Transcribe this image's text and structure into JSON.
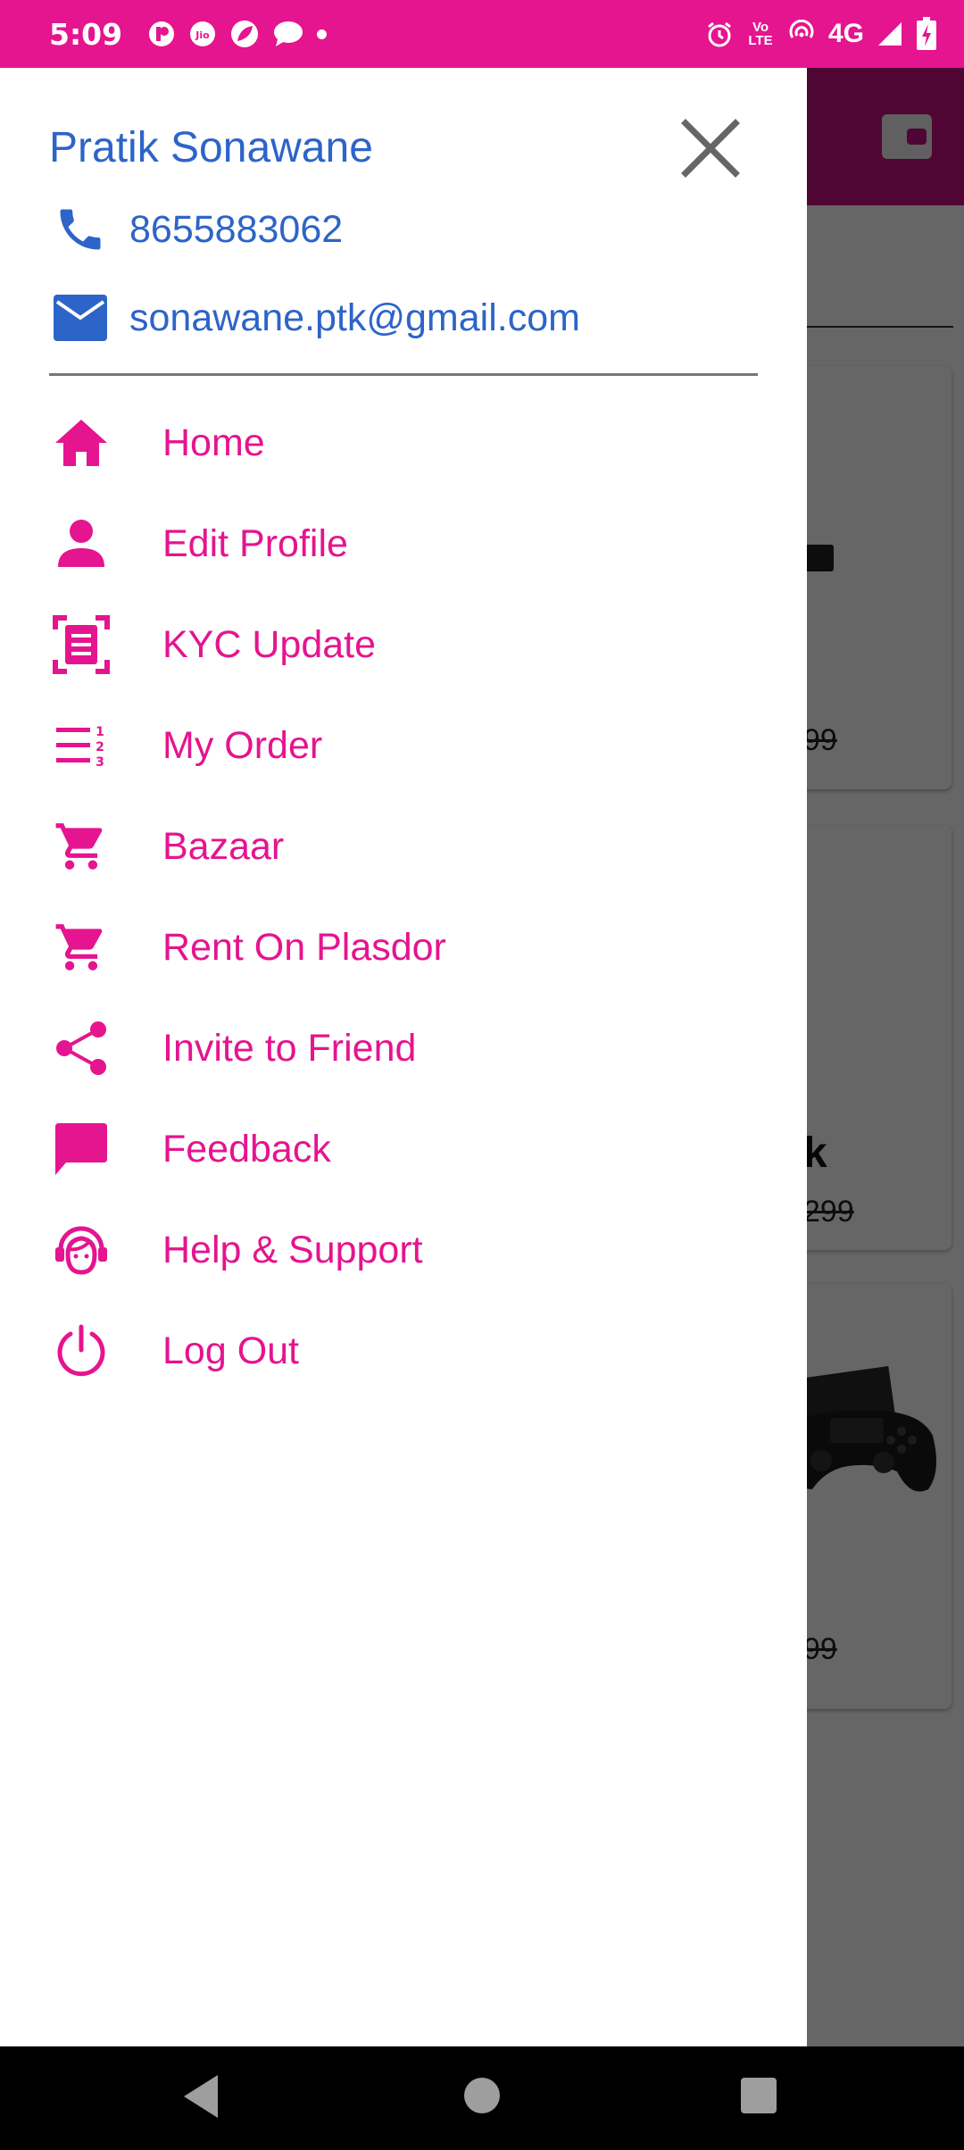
{
  "status_bar": {
    "time": "5:09",
    "network": "4G",
    "volte": "Vo LTE",
    "icons": [
      "notification-icon",
      "jio-icon",
      "leaf-icon",
      "message-icon",
      "alarm-icon",
      "hotspot-icon",
      "signal-icon",
      "battery-charging-icon"
    ]
  },
  "background": {
    "prices": [
      "99",
      "299",
      "99"
    ],
    "price_partial_letter": "k"
  },
  "drawer": {
    "user_name": "Pratik Sonawane",
    "phone": "8655883062",
    "email": "sonawane.ptk@gmail.com",
    "menu": [
      {
        "label": "Home",
        "icon": "home-icon"
      },
      {
        "label": "Edit Profile",
        "icon": "person-icon"
      },
      {
        "label": "KYC Update",
        "icon": "document-scan-icon"
      },
      {
        "label": "My Order",
        "icon": "sort-numbered-icon"
      },
      {
        "label": "Bazaar",
        "icon": "cart-icon"
      },
      {
        "label": "Rent On Plasdor",
        "icon": "cart-icon"
      },
      {
        "label": "Invite to Friend",
        "icon": "share-icon"
      },
      {
        "label": "Feedback",
        "icon": "chat-icon"
      },
      {
        "label": "Help & Support",
        "icon": "support-agent-icon"
      },
      {
        "label": "Log Out",
        "icon": "power-icon"
      }
    ]
  },
  "colors": {
    "accent": "#e5148f",
    "contact_blue": "#2d64c8",
    "status_bar": "#e5148f"
  }
}
